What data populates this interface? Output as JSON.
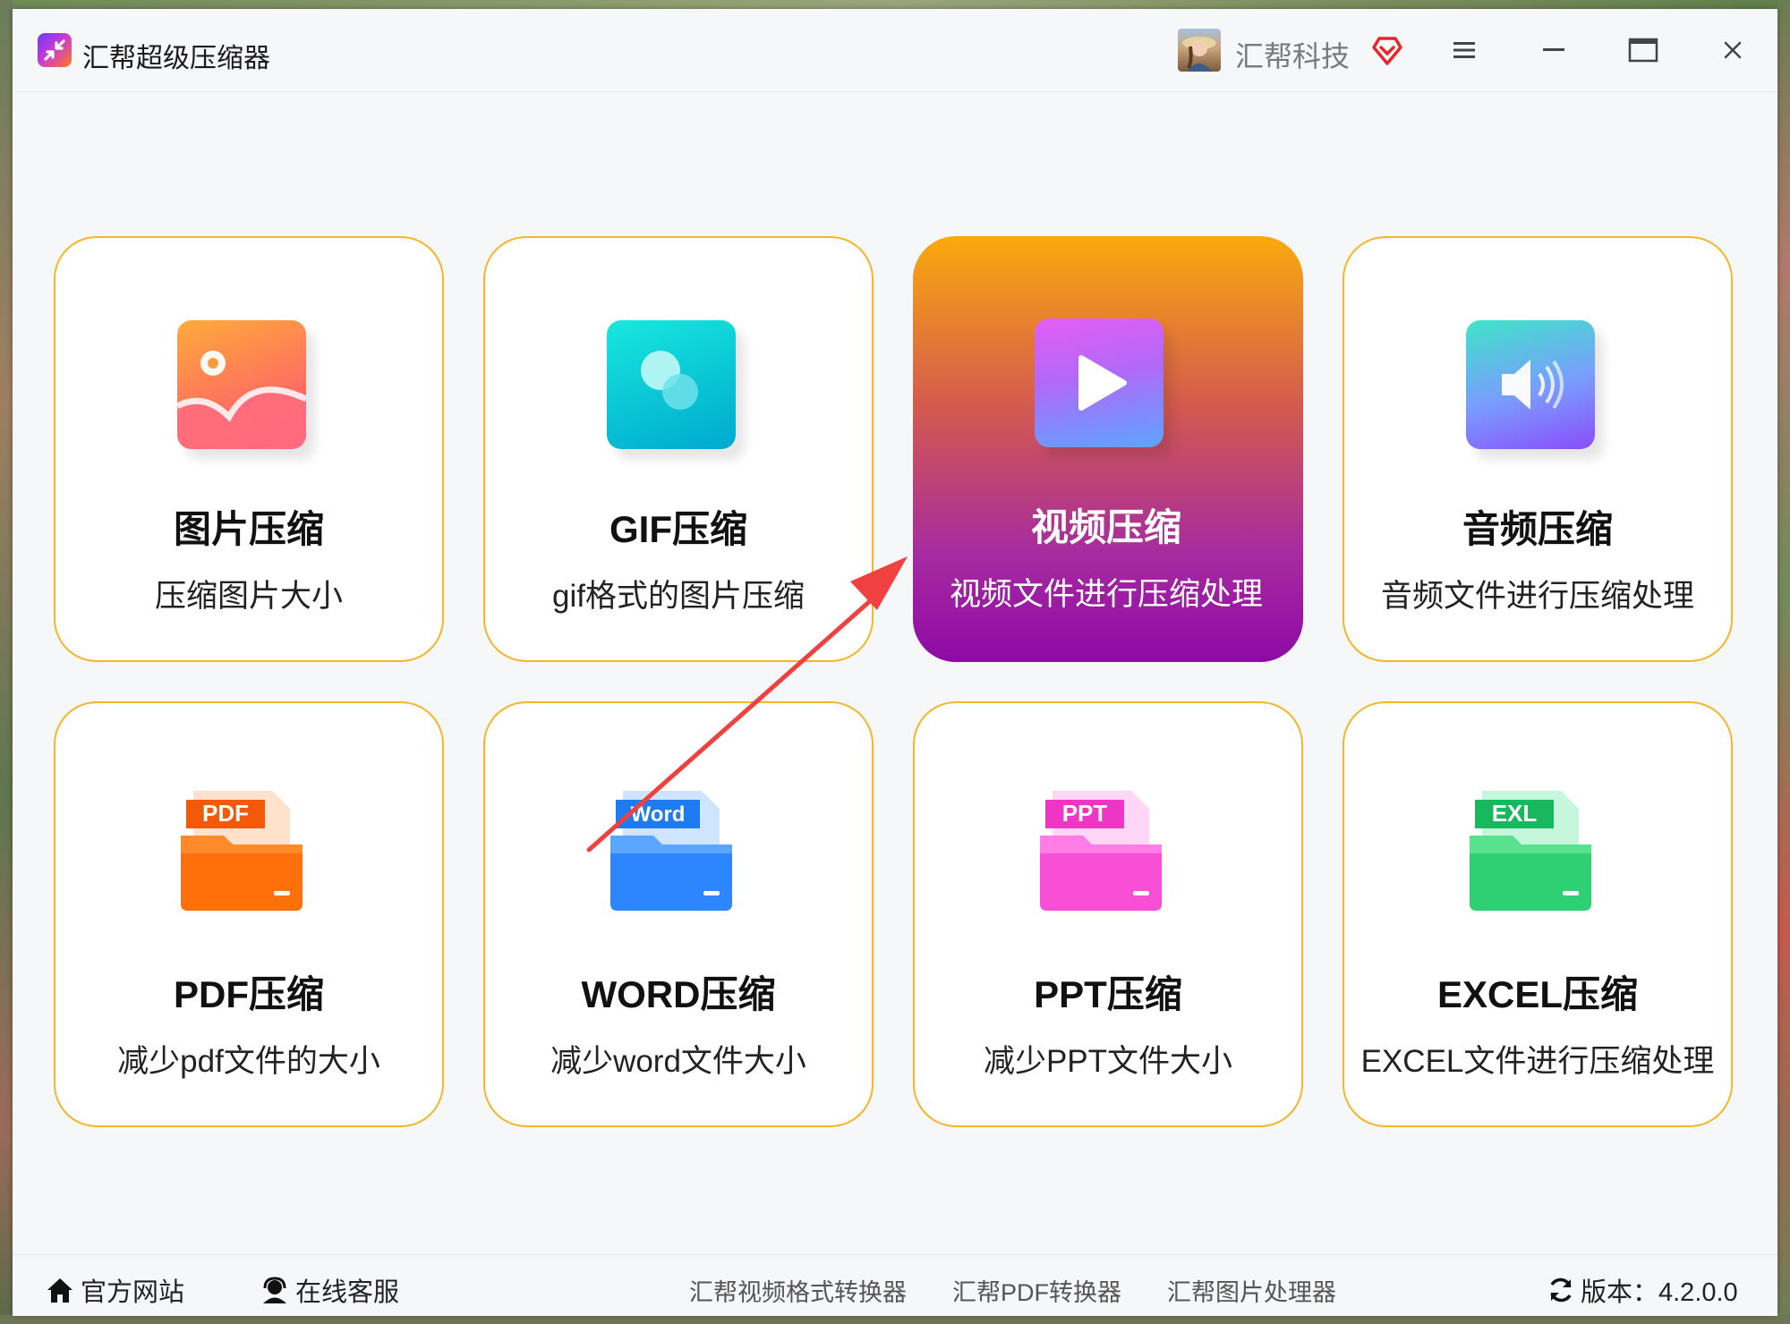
{
  "app": {
    "title": "汇帮超级压缩器",
    "user_name": "汇帮科技"
  },
  "cards": [
    {
      "title": "图片压缩",
      "sub": "压缩图片大小",
      "icon": "image-icon"
    },
    {
      "title": "GIF压缩",
      "sub": "gif格式的图片压缩",
      "icon": "gif-icon"
    },
    {
      "title": "视频压缩",
      "sub": "视频文件进行压缩处理",
      "icon": "video-play-icon",
      "selected": true
    },
    {
      "title": "音频压缩",
      "sub": "音频文件进行压缩处理",
      "icon": "audio-speaker-icon"
    },
    {
      "title": "PDF压缩",
      "sub": "减少pdf文件的大小",
      "icon": "pdf-folder-icon",
      "tag": "PDF"
    },
    {
      "title": "WORD压缩",
      "sub": "减少word文件大小",
      "icon": "word-folder-icon",
      "tag": "Word"
    },
    {
      "title": "PPT压缩",
      "sub": "减少PPT文件大小",
      "icon": "ppt-folder-icon",
      "tag": "PPT"
    },
    {
      "title": "EXCEL压缩",
      "sub": "EXCEL文件进行压缩处理",
      "icon": "excel-folder-icon",
      "tag": "EXL"
    }
  ],
  "bottom": {
    "website": "官方网站",
    "support": "在线客服",
    "links": [
      "汇帮视频格式转换器",
      "汇帮PDF转换器",
      "汇帮图片处理器"
    ],
    "version": "版本：4.2.0.0"
  },
  "colors": {
    "card_border": "#f5b62a",
    "accent_orange": "#fba90d",
    "accent_purple": "#8e0aa6",
    "arrow": "#f04040"
  }
}
